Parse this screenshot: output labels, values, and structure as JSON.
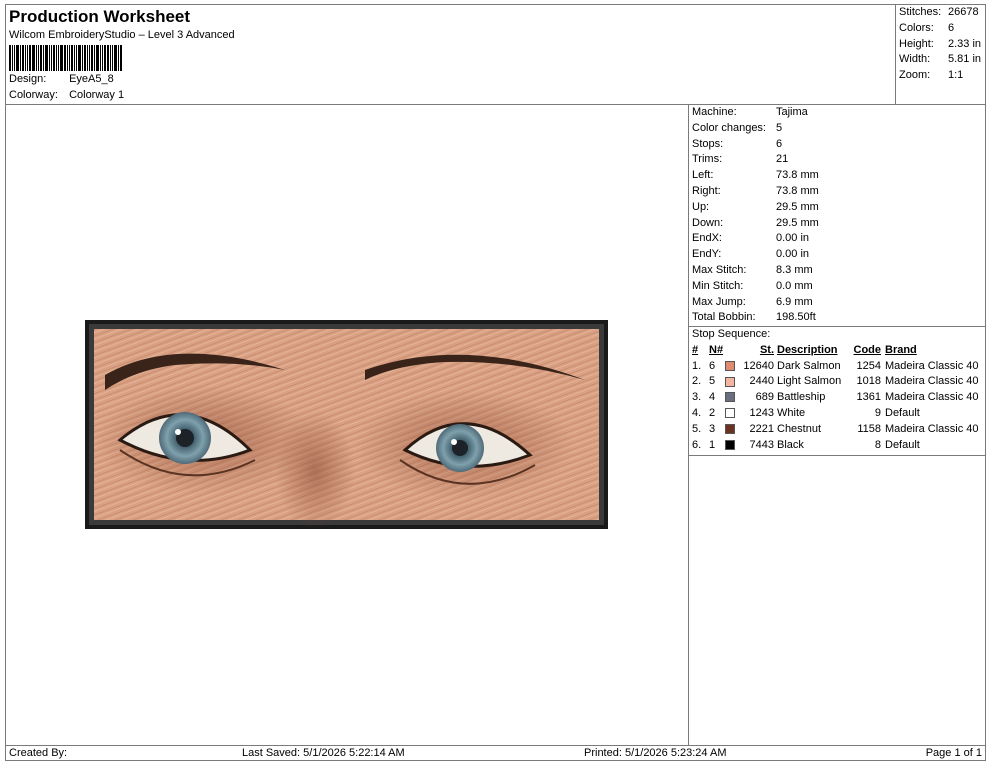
{
  "header": {
    "title": "Production Worksheet",
    "subtitle": "Wilcom EmbroideryStudio – Level 3 Advanced",
    "design_label": "Design:",
    "design_value": "EyeA5_8",
    "colorway_label": "Colorway:",
    "colorway_value": "Colorway 1"
  },
  "stats": [
    {
      "label": "Stitches:",
      "value": "26678"
    },
    {
      "label": "Colors:",
      "value": "6"
    },
    {
      "label": "Height:",
      "value": "2.33 in"
    },
    {
      "label": "Width:",
      "value": "5.81 in"
    },
    {
      "label": "Zoom:",
      "value": "1:1"
    }
  ],
  "machine_info": [
    {
      "label": "Machine:",
      "value": "Tajima"
    },
    {
      "label": "Color changes:",
      "value": "5"
    },
    {
      "label": "Stops:",
      "value": "6"
    },
    {
      "label": "Trims:",
      "value": "21"
    },
    {
      "label": "Left:",
      "value": "73.8 mm"
    },
    {
      "label": "Right:",
      "value": "73.8 mm"
    },
    {
      "label": "Up:",
      "value": "29.5 mm"
    },
    {
      "label": "Down:",
      "value": "29.5 mm"
    },
    {
      "label": "EndX:",
      "value": "0.00 in"
    },
    {
      "label": "EndY:",
      "value": "0.00 in"
    },
    {
      "label": "Max Stitch:",
      "value": "8.3 mm"
    },
    {
      "label": "Min Stitch:",
      "value": "0.0 mm"
    },
    {
      "label": "Max Jump:",
      "value": "6.9 mm"
    },
    {
      "label": "Total Bobbin:",
      "value": "198.50ft"
    }
  ],
  "stop_sequence": {
    "title": "Stop Sequence:",
    "headers": {
      "idx": "#",
      "num": "N#",
      "st": "St.",
      "desc": "Description",
      "code": "Code",
      "brand": "Brand"
    },
    "rows": [
      {
        "idx": "1.",
        "num": "6",
        "color": "#e08a72",
        "st": "12640",
        "desc": "Dark Salmon",
        "code": "1254",
        "brand": "Madeira Classic 40"
      },
      {
        "idx": "2.",
        "num": "5",
        "color": "#f2b6a0",
        "st": "2440",
        "desc": "Light Salmon",
        "code": "1018",
        "brand": "Madeira Classic 40"
      },
      {
        "idx": "3.",
        "num": "4",
        "color": "#6a6e80",
        "st": "689",
        "desc": "Battleship",
        "code": "1361",
        "brand": "Madeira Classic 40"
      },
      {
        "idx": "4.",
        "num": "2",
        "color": "#ffffff",
        "st": "1243",
        "desc": "White",
        "code": "9",
        "brand": "Default"
      },
      {
        "idx": "5.",
        "num": "3",
        "color": "#6b3222",
        "st": "2221",
        "desc": "Chestnut",
        "code": "1158",
        "brand": "Madeira Classic 40"
      },
      {
        "idx": "6.",
        "num": "1",
        "color": "#000000",
        "st": "7443",
        "desc": "Black",
        "code": "8",
        "brand": "Default"
      }
    ]
  },
  "footer": {
    "created_by": "Created By:",
    "last_saved": "Last Saved: 5/1/2026 5:22:14 AM",
    "printed": "Printed: 5/1/2026 5:23:24 AM",
    "page": "Page 1 of 1"
  }
}
